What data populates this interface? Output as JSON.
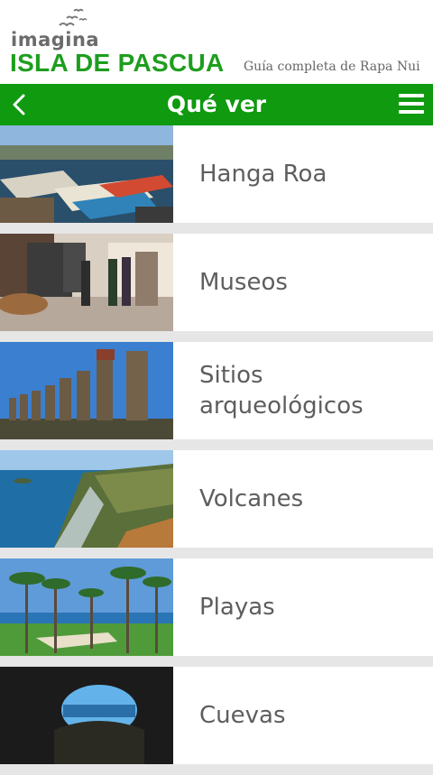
{
  "header": {
    "logo_imagina": "imagina",
    "logo_isla": "ISLA DE PASCUA",
    "tagline": "Guía completa de Rapa Nui"
  },
  "topbar": {
    "back_icon": "chevron-left-icon",
    "title": "Qué ver",
    "menu_icon": "hamburger-menu-icon"
  },
  "items": [
    {
      "label": "Hanga Roa",
      "image": "harbor-boats-photo"
    },
    {
      "label": "Museos",
      "image": "museum-interior-photo"
    },
    {
      "label": "Sitios arqueológicos",
      "image": "moai-row-photo"
    },
    {
      "label": "Volcanes",
      "image": "coastal-cliffs-photo"
    },
    {
      "label": "Playas",
      "image": "palm-beach-photo"
    },
    {
      "label": "Cuevas",
      "image": "cave-opening-photo"
    }
  ],
  "colors": {
    "brand_green": "#0f9a0f",
    "logo_green": "#1e9e1e",
    "list_text": "#5e5e5e",
    "divider": "#e6e6e6"
  }
}
